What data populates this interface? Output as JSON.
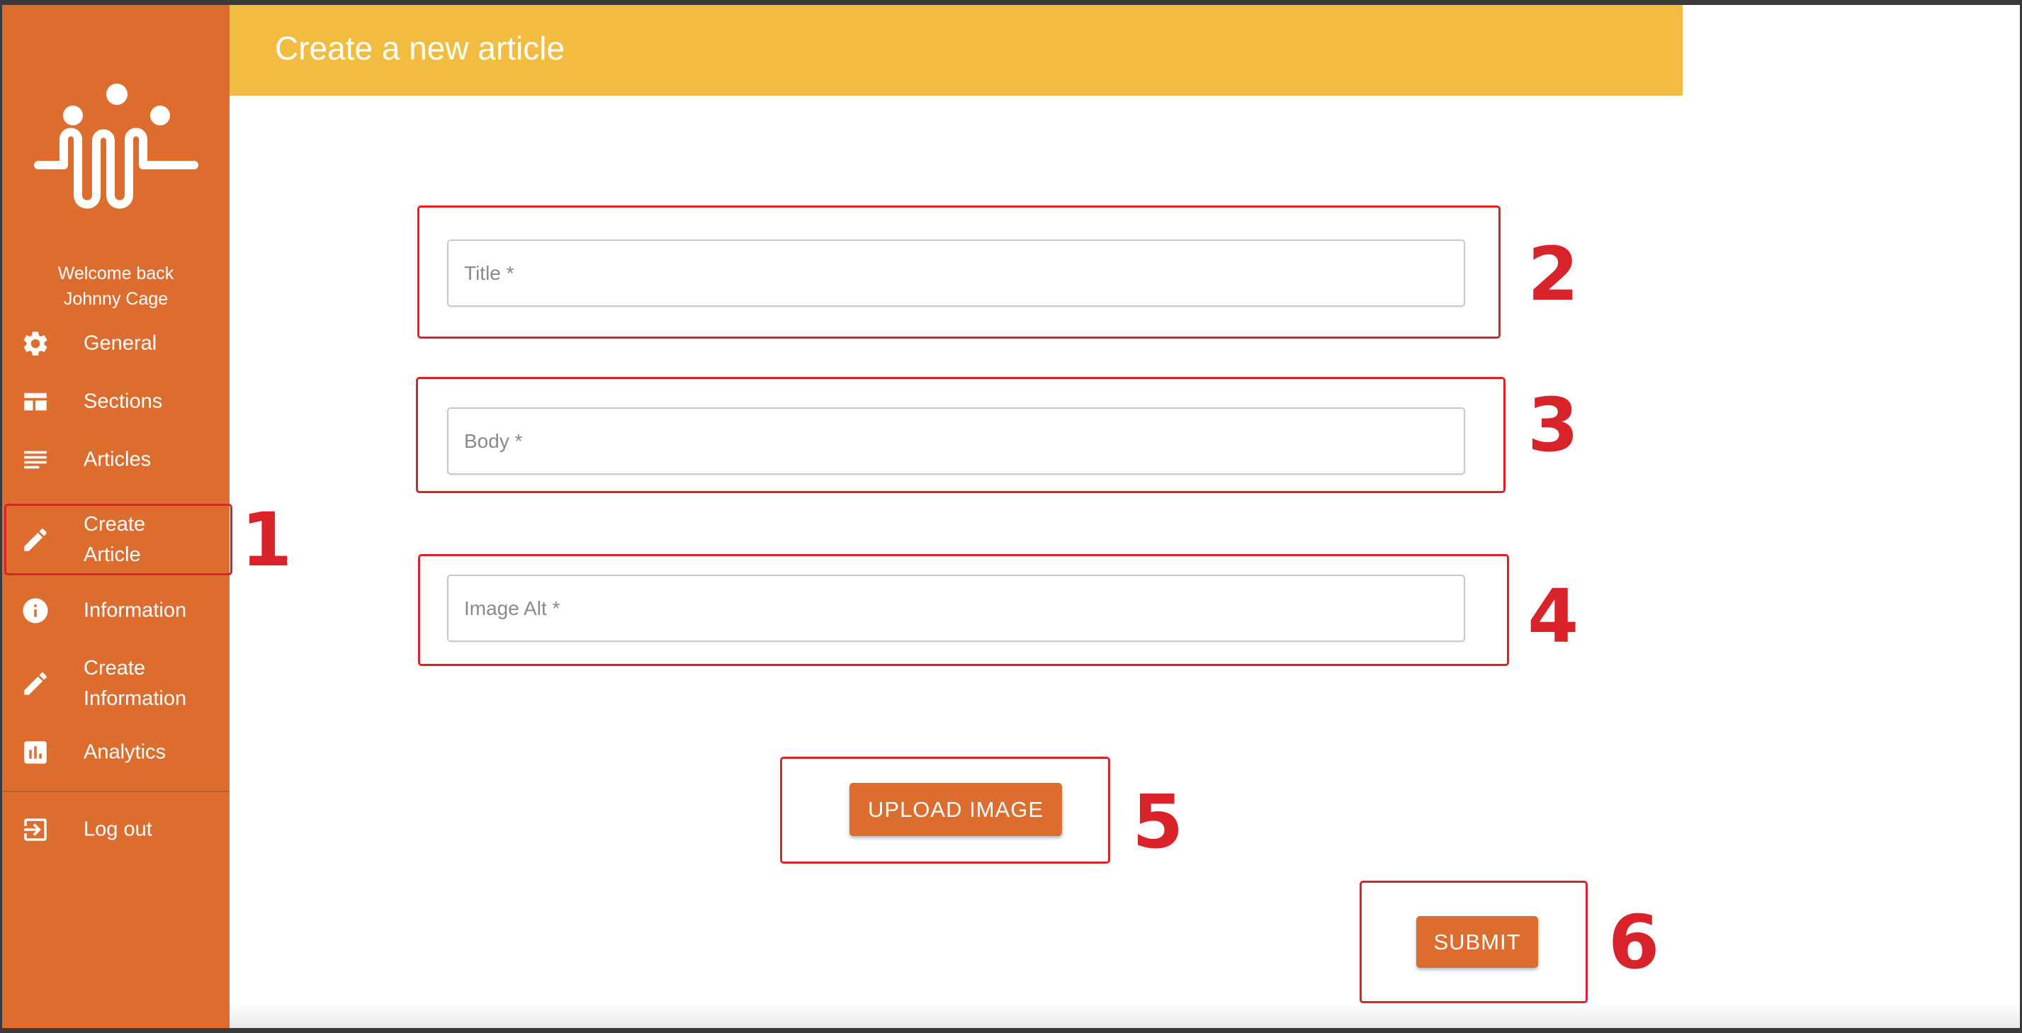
{
  "header": {
    "title": "Create a new article"
  },
  "sidebar": {
    "welcome": "Welcome back\nJohnny Cage",
    "items": [
      {
        "label": "General",
        "icon": "gear-icon"
      },
      {
        "label": "Sections",
        "icon": "sections-icon"
      },
      {
        "label": "Articles",
        "icon": "articles-icon"
      },
      {
        "label": "Create\nArticle",
        "icon": "pencil-icon"
      },
      {
        "label": "Information",
        "icon": "info-icon"
      },
      {
        "label": "Create\nInformation",
        "icon": "pencil-icon"
      },
      {
        "label": "Analytics",
        "icon": "analytics-icon"
      },
      {
        "label": "Log out",
        "icon": "logout-icon"
      }
    ]
  },
  "form": {
    "title_placeholder": "Title *",
    "body_placeholder": "Body *",
    "image_alt_placeholder": "Image Alt *",
    "upload_label": "UPLOAD IMAGE",
    "submit_label": "SUBMIT"
  },
  "annotations": [
    "1",
    "2",
    "3",
    "4",
    "5",
    "6"
  ],
  "colors": {
    "sidebar": "#dd6c2f",
    "header": "#f2bc40",
    "button": "#dd6c2f",
    "annotation": "#d8232a"
  }
}
